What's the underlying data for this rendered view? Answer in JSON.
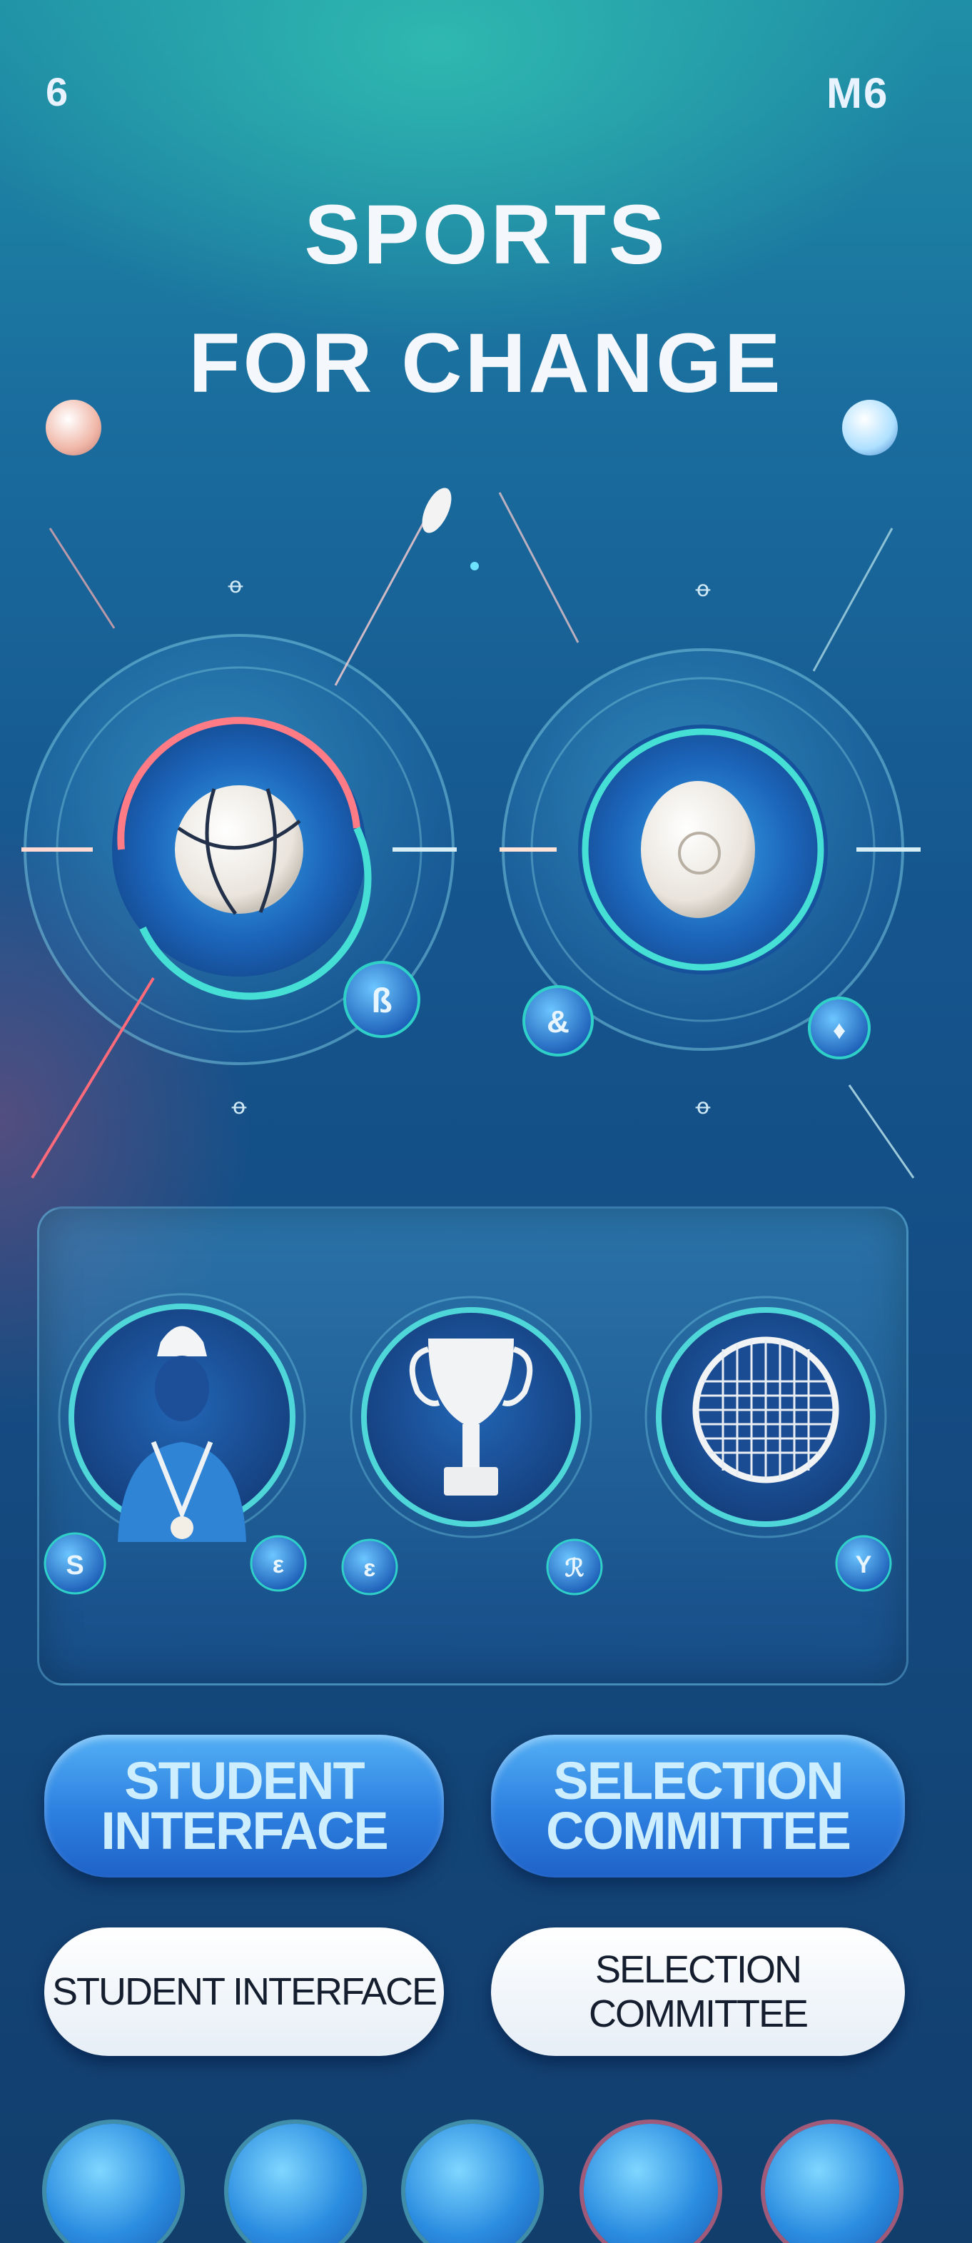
{
  "header": {
    "left_glyph": "6",
    "right_text": "M6",
    "title_line1": "SPORTS",
    "title_line2": "FOR CHANGE"
  },
  "hero": {
    "left_dial": {
      "ball": "basketball-icon",
      "badge": "small-badge-icon"
    },
    "right_dial": {
      "ball": "ball-icon",
      "badges": [
        "small-badge-icon",
        "small-badge-icon"
      ]
    }
  },
  "feature_panel": {
    "cards": [
      {
        "icon": "athlete-icon"
      },
      {
        "icon": "trophy-icon"
      },
      {
        "icon": "racket-icon"
      }
    ]
  },
  "buttons": {
    "primary_student_line1": "STUDENT",
    "primary_student_line2": "INTERFACE",
    "primary_committee_line1": "SELECTION",
    "primary_committee_line2": "COMMITTEE",
    "secondary_student": "STUDENT INTERFACE",
    "secondary_committee": "SELECTION COMMITTEE"
  },
  "bottom_nav": {
    "items": [
      "sport-icon",
      "sport-icon",
      "sport-icon",
      "sport-icon",
      "person-icon"
    ]
  },
  "colors": {
    "accent_teal": "#2fd0c8",
    "accent_red": "#ff6b7a",
    "button_blue": "#2c7fe0",
    "title_white": "#f4f7fb"
  }
}
